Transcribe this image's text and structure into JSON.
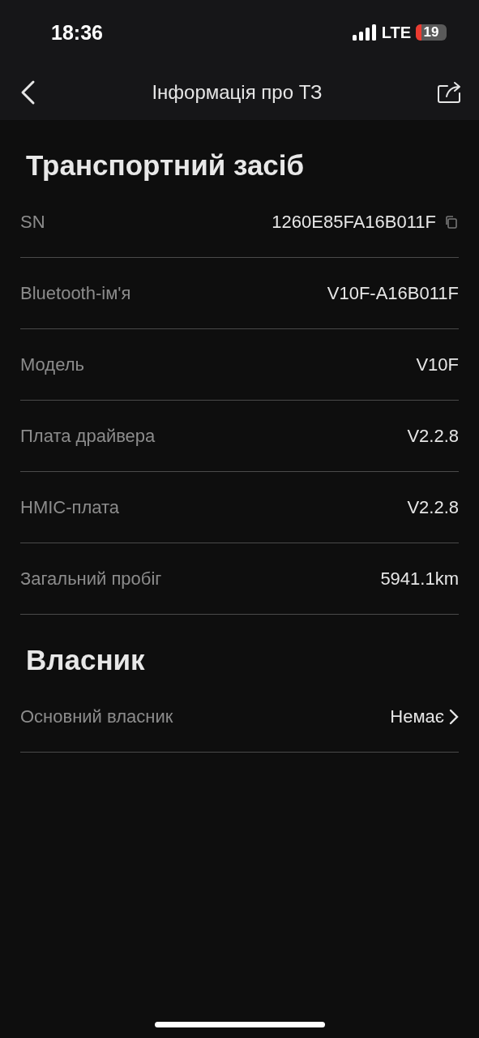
{
  "status_bar": {
    "time": "18:36",
    "network": "LTE",
    "battery": "19"
  },
  "header": {
    "title": "Інформація про ТЗ"
  },
  "sections": [
    {
      "title": "Транспортний засіб",
      "rows": [
        {
          "kind": "copy",
          "label": "SN",
          "value": "1260E85FA16B011F"
        },
        {
          "kind": "plain",
          "label": "Bluetooth-ім'я",
          "value": "V10F-A16B011F"
        },
        {
          "kind": "plain",
          "label": "Модель",
          "value": "V10F"
        },
        {
          "kind": "plain",
          "label": "Плата драйвера",
          "value": "V2.2.8"
        },
        {
          "kind": "plain",
          "label": "HMIC-плата",
          "value": "V2.2.8"
        },
        {
          "kind": "plain",
          "label": "Загальний пробіг",
          "value": "5941.1km"
        }
      ]
    },
    {
      "title": "Власник",
      "rows": [
        {
          "kind": "link",
          "label": "Основний власник",
          "value": "Немає"
        }
      ]
    }
  ]
}
